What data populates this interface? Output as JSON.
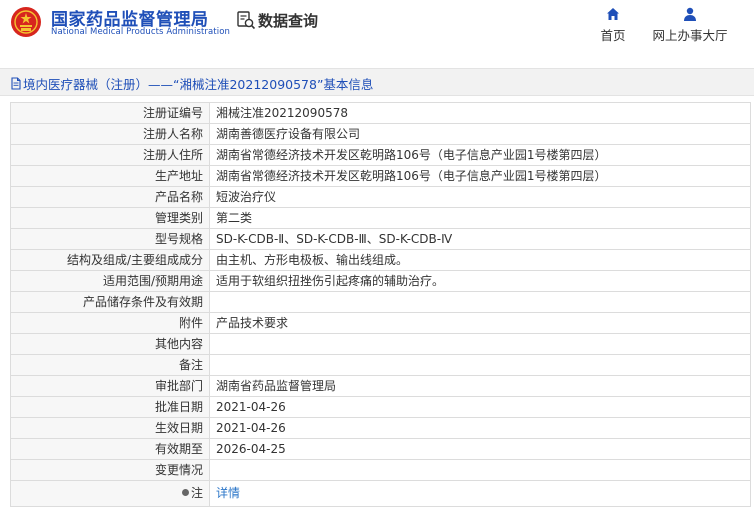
{
  "header": {
    "brand_cn": "国家药品监督管理局",
    "brand_en": "National Medical Products Administration",
    "query_label": "数据查询",
    "nav": {
      "home": "首页",
      "hall": "网上办事大厅"
    }
  },
  "breadcrumb": "境内医疗器械（注册）——“湘械注准20212090578”基本信息",
  "rows": [
    {
      "key": "注册证编号",
      "value": "湘械注准20212090578"
    },
    {
      "key": "注册人名称",
      "value": "湖南善德医疗设备有限公司"
    },
    {
      "key": "注册人住所",
      "value": "湖南省常德经济技术开发区乾明路106号（电子信息产业园1号楼第四层）"
    },
    {
      "key": "生产地址",
      "value": "湖南省常德经济技术开发区乾明路106号（电子信息产业园1号楼第四层）"
    },
    {
      "key": "产品名称",
      "value": "短波治疗仪"
    },
    {
      "key": "管理类别",
      "value": "第二类"
    },
    {
      "key": "型号规格",
      "value": "SD-K-CDB-Ⅱ、SD-K-CDB-Ⅲ、SD-K-CDB-Ⅳ"
    },
    {
      "key": "结构及组成/主要组成成分",
      "value": "由主机、方形电极板、输出线组成。"
    },
    {
      "key": "适用范围/预期用途",
      "value": "适用于软组织扭挫伤引起疼痛的辅助治疗。"
    },
    {
      "key": "产品储存条件及有效期",
      "value": ""
    },
    {
      "key": "附件",
      "value": "产品技术要求"
    },
    {
      "key": "其他内容",
      "value": ""
    },
    {
      "key": "备注",
      "value": ""
    },
    {
      "key": "审批部门",
      "value": "湖南省药品监督管理局"
    },
    {
      "key": "批准日期",
      "value": "2021-04-26"
    },
    {
      "key": "生效日期",
      "value": "2021-04-26"
    },
    {
      "key": "有效期至",
      "value": "2026-04-25"
    },
    {
      "key": "变更情况",
      "value": ""
    }
  ],
  "note": {
    "key": "注",
    "link": "详情"
  },
  "colors": {
    "brand": "#1f4fb8",
    "link": "#2a75c8",
    "emblem": "#d7261e"
  }
}
